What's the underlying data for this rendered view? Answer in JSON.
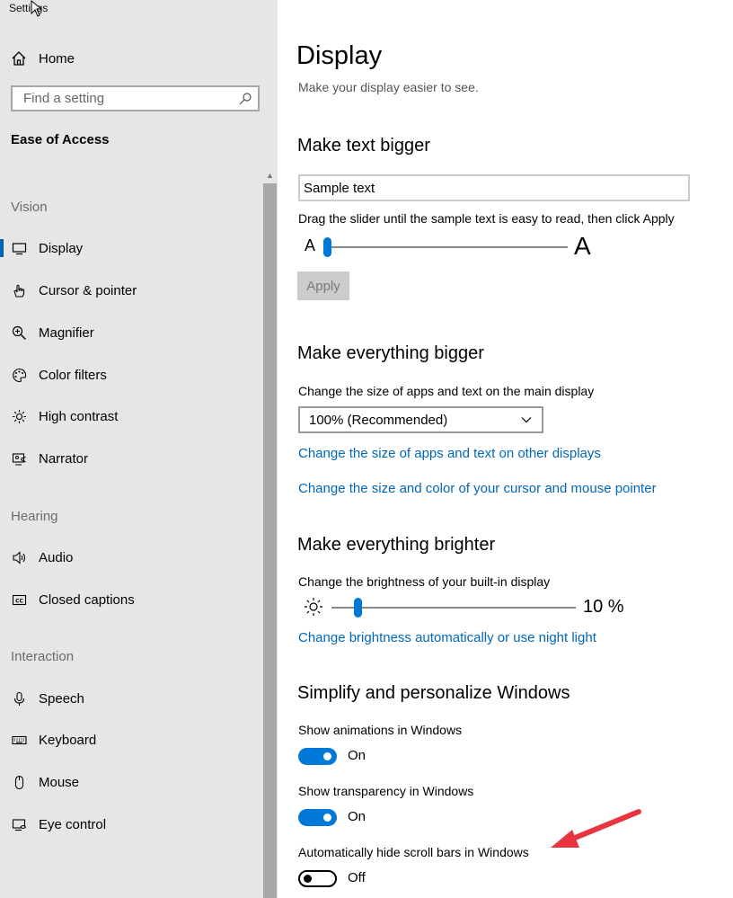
{
  "window": {
    "title": "Settings"
  },
  "sidebar": {
    "home_label": "Home",
    "search_placeholder": "Find a setting",
    "category": "Ease of Access",
    "groups": [
      {
        "title": "Vision",
        "items": [
          "Display",
          "Cursor & pointer",
          "Magnifier",
          "Color filters",
          "High contrast",
          "Narrator"
        ]
      },
      {
        "title": "Hearing",
        "items": [
          "Audio",
          "Closed captions"
        ]
      },
      {
        "title": "Interaction",
        "items": [
          "Speech",
          "Keyboard",
          "Mouse",
          "Eye control"
        ]
      }
    ],
    "active_item": "Display"
  },
  "main": {
    "title": "Display",
    "subtitle": "Make your display easier to see.",
    "text_bigger": {
      "title": "Make text bigger",
      "sample_value": "Sample text",
      "instruction": "Drag the slider until the sample text is easy to read, then click Apply",
      "small_a": "A",
      "large_a": "A",
      "slider_value_fraction": 0.0,
      "apply_label": "Apply"
    },
    "everything_bigger": {
      "title": "Make everything bigger",
      "label": "Change the size of apps and text on the main display",
      "dropdown_value": "100% (Recommended)",
      "link_other_displays": "Change the size of apps and text on other displays",
      "link_cursor": "Change the size and color of your cursor and mouse pointer"
    },
    "everything_brighter": {
      "title": "Make everything brighter",
      "label": "Change the brightness of your built-in display",
      "value_text": "10 %",
      "value_fraction": 0.1,
      "link_night_light": "Change brightness automatically or use night light"
    },
    "simplify": {
      "title": "Simplify and personalize Windows",
      "toggles": [
        {
          "label": "Show animations in Windows",
          "state": "On",
          "on": true
        },
        {
          "label": "Show transparency in Windows",
          "state": "On",
          "on": true
        },
        {
          "label": "Automatically hide scroll bars in Windows",
          "state": "Off",
          "on": false
        }
      ]
    }
  },
  "colors": {
    "accent": "#0078d7",
    "link": "#0067b8",
    "sidebar_bg": "#e6e6e6",
    "annotation": "#e8343f"
  }
}
